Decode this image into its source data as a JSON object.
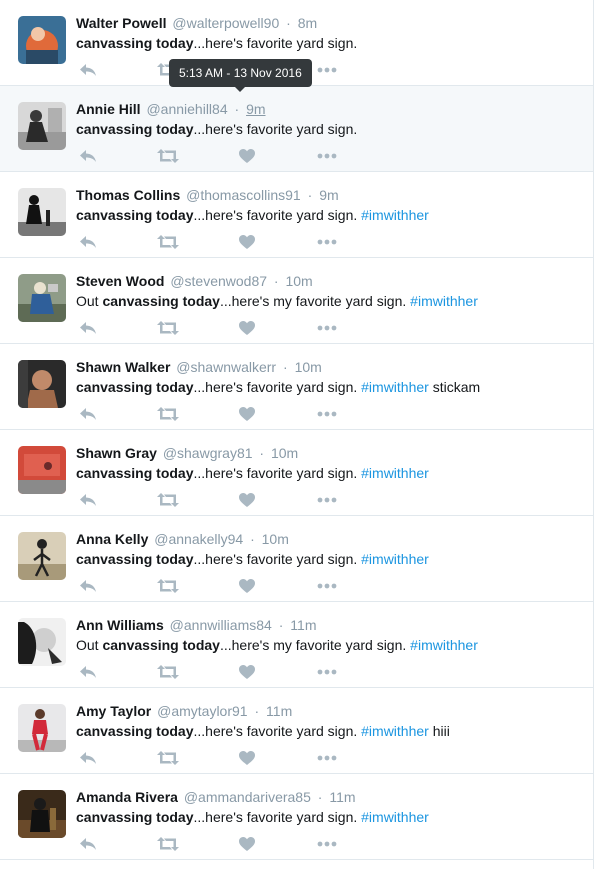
{
  "tooltip": {
    "text": "5:13 AM - 13 Nov 2016"
  },
  "icons": {
    "reply": "reply-icon",
    "retweet": "retweet-icon",
    "like": "heart-icon",
    "more": "more-dots-icon"
  },
  "colors": {
    "name": "#14171a",
    "meta": "#8899a6",
    "hashtag": "#1b95e0",
    "icon": "#aab8c2",
    "hover_bg": "#f5f8fa",
    "tooltip_bg": "#34393c"
  },
  "tweets": [
    {
      "name": "Walter Powell",
      "handle": "@walterpowell90",
      "time": "8m",
      "pre": "",
      "bold": "canvassing today",
      "rest": "...here's favorite yard sign.",
      "hashtag": "",
      "post": ""
    },
    {
      "name": "Annie Hill",
      "handle": "@anniehill84",
      "time": "9m",
      "pre": "",
      "bold": "canvassing today",
      "rest": "...here's favorite yard sign.",
      "hashtag": "",
      "post": ""
    },
    {
      "name": "Thomas Collins",
      "handle": "@thomascollins91",
      "time": "9m",
      "pre": "",
      "bold": "canvassing today",
      "rest": "...here's favorite yard sign. ",
      "hashtag": "#imwithher",
      "post": ""
    },
    {
      "name": "Steven Wood",
      "handle": "@stevenwod87",
      "time": "10m",
      "pre": "Out ",
      "bold": "canvassing today",
      "rest": "...here's my favorite yard sign. ",
      "hashtag": "#imwithher",
      "post": ""
    },
    {
      "name": "Shawn Walker",
      "handle": "@shawnwalkerr",
      "time": "10m",
      "pre": "",
      "bold": "canvassing today",
      "rest": "...here's favorite yard sign. ",
      "hashtag": "#imwithher",
      "post": " stickam"
    },
    {
      "name": "Shawn Gray",
      "handle": "@shawgray81",
      "time": "10m",
      "pre": "",
      "bold": "canvassing today",
      "rest": "...here's favorite yard sign. ",
      "hashtag": "#imwithher",
      "post": ""
    },
    {
      "name": "Anna Kelly",
      "handle": "@annakelly94",
      "time": "10m",
      "pre": "",
      "bold": "canvassing today",
      "rest": "...here's favorite yard sign. ",
      "hashtag": "#imwithher",
      "post": ""
    },
    {
      "name": "Ann Williams",
      "handle": "@annwilliams84",
      "time": "11m",
      "pre": "Out ",
      "bold": "canvassing today",
      "rest": "...here's my favorite yard sign. ",
      "hashtag": "#imwithher",
      "post": ""
    },
    {
      "name": "Amy Taylor",
      "handle": "@amytaylor91",
      "time": "11m",
      "pre": "",
      "bold": "canvassing today",
      "rest": "...here's favorite yard sign. ",
      "hashtag": "#imwithher",
      "post": " hiii"
    },
    {
      "name": "Amanda Rivera",
      "handle": "@ammandarivera85",
      "time": "11m",
      "pre": "",
      "bold": "canvassing today",
      "rest": "...here's favorite yard sign. ",
      "hashtag": "#imwithher",
      "post": ""
    }
  ]
}
